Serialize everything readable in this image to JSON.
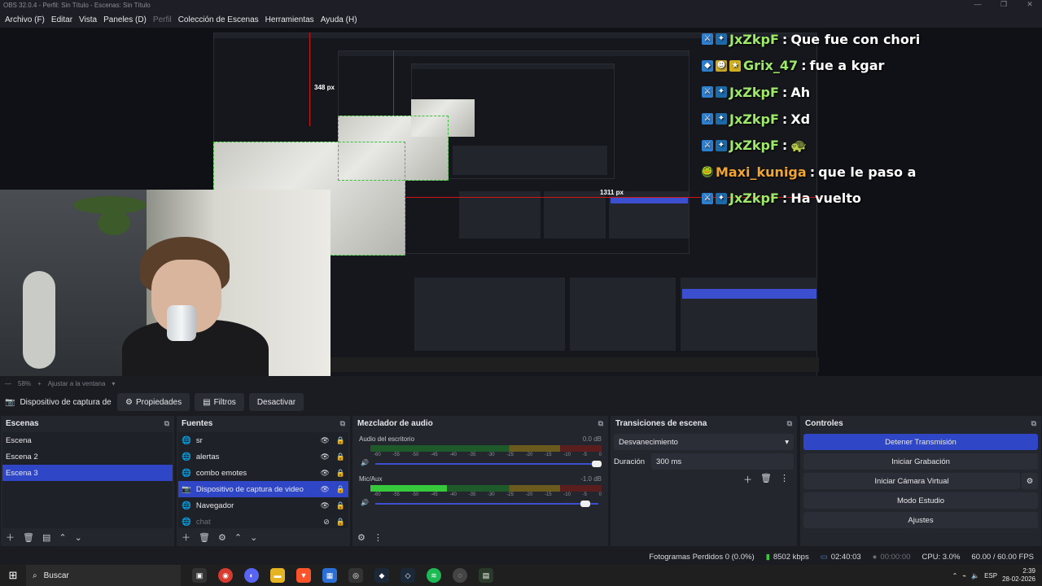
{
  "window": {
    "title": "OBS 32.0.4 - Perfil: Sin Título - Escenas: Sin Título",
    "minimize": "—",
    "maximize": "❐",
    "close": "✕"
  },
  "menu": [
    {
      "label": "Archivo (F)"
    },
    {
      "label": "Editar"
    },
    {
      "label": "Vista"
    },
    {
      "label": "Paneles (D)"
    },
    {
      "label": "Perfil",
      "dim": true
    },
    {
      "label": "Colección de Escenas"
    },
    {
      "label": "Herramientas"
    },
    {
      "label": "Ayuda (H)"
    }
  ],
  "preview": {
    "measure_vertical": "348 px",
    "measure_horizontal": "1311 px",
    "chat": [
      {
        "badges": [
          "⚔",
          "✦"
        ],
        "user": "JxZkpF",
        "message": "Que fue con chori",
        "color": "green"
      },
      {
        "badges": [
          "◆",
          "☻",
          "★"
        ],
        "user": "Grix_47",
        "message": "fue a kgar",
        "color": "green"
      },
      {
        "badges": [
          "⚔",
          "✦"
        ],
        "user": "JxZkpF",
        "message": "Ah",
        "color": "green"
      },
      {
        "badges": [
          "⚔",
          "✦"
        ],
        "user": "JxZkpF",
        "message": "Xd",
        "color": "green"
      },
      {
        "badges": [
          "⚔",
          "✦"
        ],
        "user": "JxZkpF",
        "message": "🐢",
        "color": "green"
      },
      {
        "badges": [
          "🐸"
        ],
        "user": "Maxi_kuniga",
        "message": "que le paso a",
        "color": "orange"
      },
      {
        "badges": [
          "⚔",
          "✦"
        ],
        "user": "JxZkpF",
        "message": "Ha vuelto",
        "color": "green"
      }
    ]
  },
  "zoom": {
    "value": "58%",
    "fit_label": "Ajustar a la ventana"
  },
  "sourcebar": {
    "source_name": "Dispositivo de captura de v",
    "properties": "Propiedades",
    "filters": "Filtros",
    "disable": "Desactivar"
  },
  "scenes": {
    "title": "Escenas",
    "items": [
      {
        "label": "Escena",
        "selected": false
      },
      {
        "label": "Escena 2",
        "selected": false
      },
      {
        "label": "Escena 3",
        "selected": true
      }
    ]
  },
  "sources": {
    "title": "Fuentes",
    "items": [
      {
        "label": "sr",
        "icon": "🌐",
        "selected": false,
        "visible": true
      },
      {
        "label": "alertas",
        "icon": "🌐",
        "selected": false,
        "visible": true
      },
      {
        "label": "combo emotes",
        "icon": "🌐",
        "selected": false,
        "visible": true
      },
      {
        "label": "Dispositivo de captura de video",
        "icon": "📷",
        "selected": true,
        "visible": true
      },
      {
        "label": "Navegador",
        "icon": "🌐",
        "selected": false,
        "visible": true
      },
      {
        "label": "chat",
        "icon": "🌐",
        "selected": false,
        "visible": false
      }
    ]
  },
  "mixer": {
    "title": "Mezclador de audio",
    "ticks": [
      "-60",
      "-55",
      "-50",
      "-45",
      "-40",
      "-35",
      "-30",
      "-25",
      "-20",
      "-15",
      "-10",
      "-5",
      "0"
    ],
    "channels": [
      {
        "name": "Audio del escritorio",
        "db": "0.0 dB",
        "level": 0.0,
        "volume": 1.0
      },
      {
        "name": "Mic/Aux",
        "db": "-1.0 dB",
        "level": 0.33,
        "volume": 0.95
      }
    ]
  },
  "transitions": {
    "title": "Transiciones de escena",
    "selected": "Desvanecimiento",
    "duration_label": "Duración",
    "duration_value": "300 ms"
  },
  "controls": {
    "title": "Controles",
    "stop_stream": "Detener Transmisión",
    "start_recording": "Iniciar Grabación",
    "start_virtual_cam": "Iniciar Cámara Virtual",
    "studio_mode": "Modo Estudio",
    "settings": "Ajustes"
  },
  "status": {
    "dropped_frames": "Fotogramas Perdidos 0 (0.0%)",
    "bitrate": "8502 kbps",
    "stream_time": "02:40:03",
    "rec_time": "00:00:00",
    "cpu": "CPU: 3.0%",
    "fps": "60.00 / 60.00 FPS"
  },
  "taskbar": {
    "search_placeholder": "Buscar",
    "language": "ESP",
    "time": "2:39",
    "date": "28-02-2026"
  },
  "colors": {
    "accent": "#2f47c7",
    "dock_bg": "#24262e",
    "meter_green": "#36c93c",
    "chat_user_green": "#9ee86a",
    "chat_user_orange": "#f2a531"
  }
}
